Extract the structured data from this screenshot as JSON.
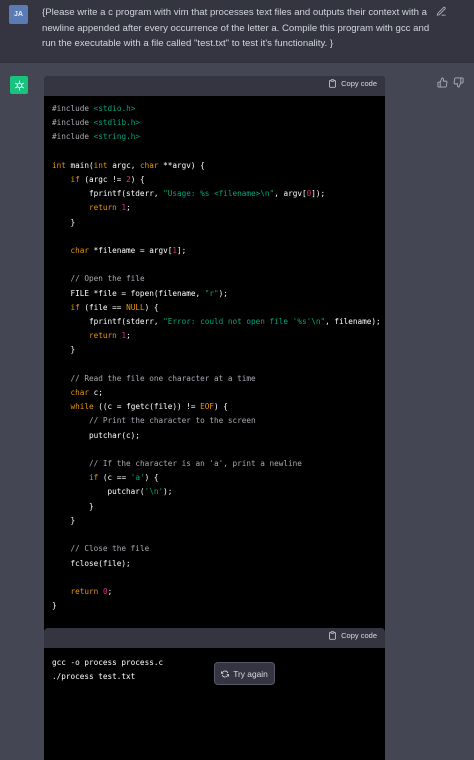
{
  "user": {
    "avatar_initials": "JA",
    "prompt": "{Please write a c program with vim that processes text files and outputs their context with a newline appended after every occurrence of the letter a. Compile this program with gcc and run the executable with a file called \"test.txt\" to test it's functionality. }"
  },
  "assistant": {
    "copy_label": "Copy code",
    "code_lines": [
      "#include <stdio.h>",
      "#include <stdlib.h>",
      "#include <string.h>",
      "",
      "int main(int argc, char **argv) {",
      "    if (argc != 2) {",
      "        fprintf(stderr, \"Usage: %s <filename>\\n\", argv[0]);",
      "        return 1;",
      "    }",
      "",
      "    char *filename = argv[1];",
      "",
      "    // Open the file",
      "    FILE *file = fopen(filename, \"r\");",
      "    if (file == NULL) {",
      "        fprintf(stderr, \"Error: could not open file '%s'\\n\", filename);",
      "        return 1;",
      "    }",
      "",
      "    // Read the file one character at a time",
      "    char c;",
      "    while ((c = fgetc(file)) != EOF) {",
      "        // Print the character to the screen",
      "        putchar(c);",
      "",
      "        // If the character is an 'a', print a newline",
      "        if (c == 'a') {",
      "            putchar('\\n');",
      "        }",
      "    }",
      "",
      "    // Close the file",
      "    fclose(file);",
      "",
      "    return 0;",
      "}"
    ],
    "copy_label_2": "Copy code",
    "code2_lines": [
      "gcc -o process process.c",
      "./process test.txt"
    ],
    "try_again_label": "Try again"
  },
  "colors": {
    "background": "#444654",
    "user_background": "#343541",
    "code_background": "#000000",
    "keyword": "#e9950c",
    "string": "#00a67d",
    "number": "#df3079",
    "comment": "#a9a9b3",
    "brand_green": "#19c37d"
  },
  "icons": {
    "edit": "pencil-icon",
    "copy": "clipboard-icon",
    "thumbs_up": "thumbs-up-icon",
    "thumbs_down": "thumbs-down-icon",
    "try_again": "refresh-icon",
    "assistant_avatar": "openai-logo-icon"
  }
}
